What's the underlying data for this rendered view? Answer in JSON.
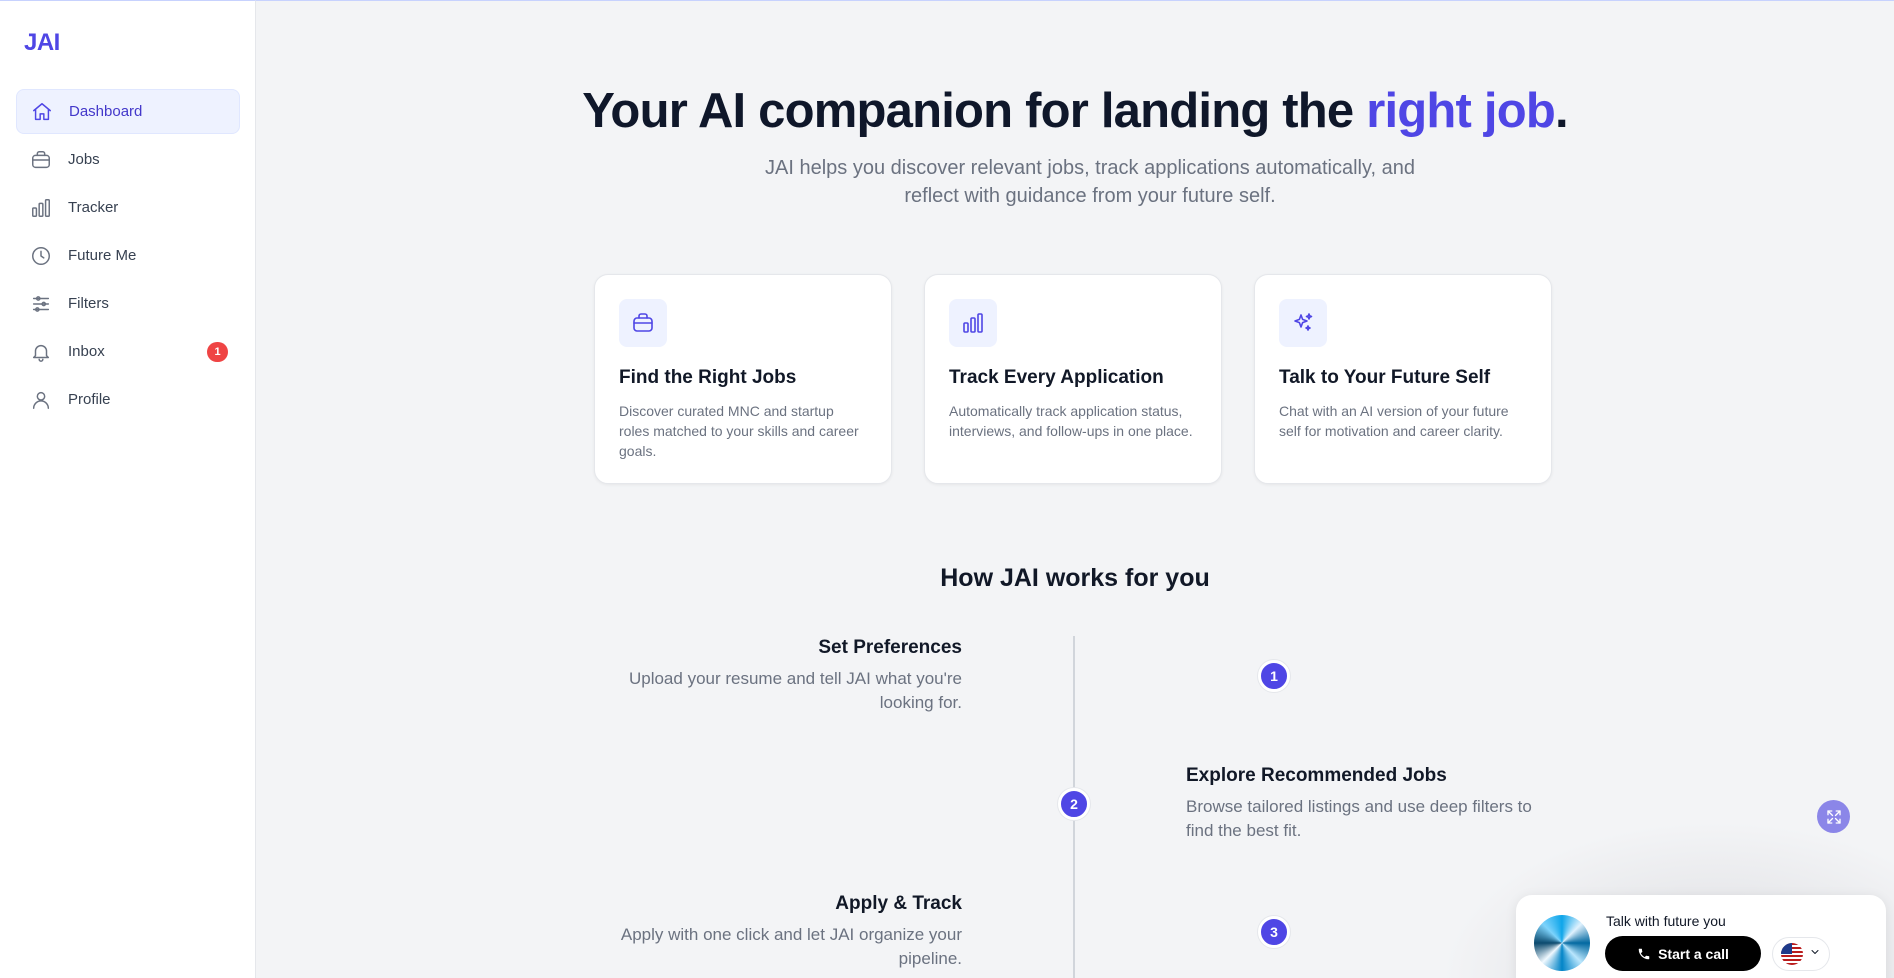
{
  "app": {
    "logo": "JAI"
  },
  "sidebar": {
    "items": [
      {
        "label": "Dashboard",
        "icon": "home-icon",
        "active": true
      },
      {
        "label": "Jobs",
        "icon": "briefcase-icon"
      },
      {
        "label": "Tracker",
        "icon": "bar-chart-icon"
      },
      {
        "label": "Future Me",
        "icon": "clock-icon"
      },
      {
        "label": "Filters",
        "icon": "sliders-icon"
      },
      {
        "label": "Inbox",
        "icon": "bell-icon",
        "badge": "1"
      },
      {
        "label": "Profile",
        "icon": "user-icon"
      }
    ]
  },
  "hero": {
    "title_prefix": "Your AI companion for landing the ",
    "title_accent": "right job",
    "title_suffix": ".",
    "subtitle": "JAI helps you discover relevant jobs, track applications automatically, and reflect with guidance from your future self."
  },
  "features": [
    {
      "icon": "briefcase-icon",
      "title": "Find the Right Jobs",
      "desc": "Discover curated MNC and startup roles matched to your skills and career goals."
    },
    {
      "icon": "bar-chart-icon",
      "title": "Track Every Application",
      "desc": "Automatically track application status, interviews, and follow-ups in one place."
    },
    {
      "icon": "sparkles-icon",
      "title": "Talk to Your Future Self",
      "desc": "Chat with an AI version of your future self for motivation and career clarity."
    }
  ],
  "how": {
    "title": "How JAI works for you",
    "steps": [
      {
        "num": "1",
        "title": "Set Preferences",
        "desc": "Upload your resume and tell JAI what you're looking for."
      },
      {
        "num": "2",
        "title": "Explore Recommended Jobs",
        "desc": "Browse tailored listings and use deep filters to find the best fit."
      },
      {
        "num": "3",
        "title": "Apply & Track",
        "desc": "Apply with one click and let JAI organize your pipeline."
      }
    ]
  },
  "widget": {
    "label": "Talk with future you",
    "call_button": "Start a call",
    "language_flag": "us-flag-icon"
  },
  "colors": {
    "accent": "#4f46e5",
    "badge": "#ef4444",
    "background": "#f3f4f6"
  }
}
